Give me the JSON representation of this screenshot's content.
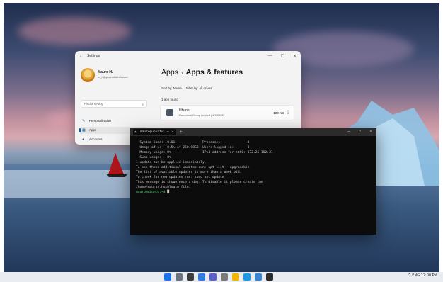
{
  "settings_window": {
    "title": "Settings",
    "controls": [
      "—",
      "☐",
      "✕"
    ],
    "user": {
      "name": "Mauro H.",
      "email": "m_h@pureinfotech.com"
    },
    "search_placeholder": "Find a setting",
    "nav": [
      {
        "label": "Personalization",
        "icon": "brush-icon"
      },
      {
        "label": "Apps",
        "icon": "apps-icon",
        "active": true
      },
      {
        "label": "Accounts",
        "icon": "person-icon"
      }
    ],
    "breadcrumb": {
      "parent": "Apps",
      "separator": "›",
      "current": "Apps & features"
    },
    "filters_text": "Sort by: Name  ⌄   Filter by: All drives  ⌄",
    "apps_found": "1 app found",
    "app": {
      "name": "Ubuntu",
      "publisher_date": "Canonical Group Limited  |  1/2/2022",
      "size": "100 KB"
    }
  },
  "terminal": {
    "tab_title": "mauro@ubuntu: ~",
    "tab_icon": "linux-icon",
    "new_tab": "+",
    "controls": [
      "—",
      "☐",
      "✕"
    ],
    "lines": [
      "  System load:  0.01              Processes:             8",
      "  Usage of /:   0.5% of 250.98GB  Users logged in:       0",
      "  Memory usage: 0%                IPv4 address for eth0: 172.25.102.31",
      "  Swap usage:   0%",
      "",
      "1 update can be applied immediately.",
      "To see these additional updates run: apt list --upgradable",
      "",
      "",
      "The list of available updates is more than a week old.",
      "To check for new updates run: sudo apt update",
      "",
      "",
      "This message is shown once a day. To disable it please create the",
      "/home/mauro/.hushlogin file."
    ],
    "prompt": "mauro@ubuntu:~$",
    "cursor": " █"
  },
  "taskbar": {
    "icons": [
      {
        "name": "start-icon",
        "color": "#1a73e8"
      },
      {
        "name": "search-icon",
        "color": "#6b7280"
      },
      {
        "name": "task-view-icon",
        "color": "#3b3b3b"
      },
      {
        "name": "widgets-icon",
        "color": "#2f7de1"
      },
      {
        "name": "chat-icon",
        "color": "#5b5fc7"
      },
      {
        "name": "settings-icon",
        "color": "#7a7a7a"
      },
      {
        "name": "file-explorer-icon",
        "color": "#f4b400"
      },
      {
        "name": "edge-icon",
        "color": "#1e9be0"
      },
      {
        "name": "store-icon",
        "color": "#3a86d4"
      },
      {
        "name": "terminal-icon",
        "color": "#2b2b2b"
      }
    ],
    "tray_text": "^  ENG  12:00 PM"
  }
}
